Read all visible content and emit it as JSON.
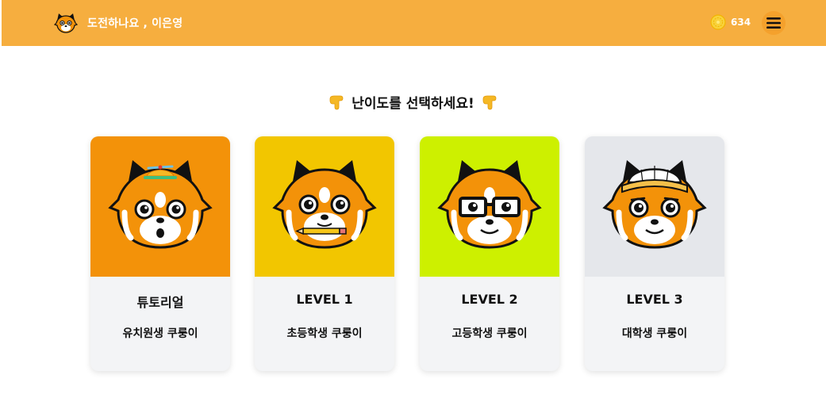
{
  "header": {
    "greeting": "도전하나요 , 이은영",
    "coins": "634",
    "colors": {
      "bar": "#f6ae3f",
      "text": "#ffffff"
    }
  },
  "prompt": {
    "text": "난이도를 선택하세요!"
  },
  "levels": [
    {
      "title": "튜토리얼",
      "subtitle": "유치원생 쿠룽이",
      "bg": "#f39209",
      "icon": "red-panda-propeller-hat-icon"
    },
    {
      "title": "LEVEL 1",
      "subtitle": "초등학생 쿠룽이",
      "bg": "#f2c600",
      "icon": "red-panda-pencil-icon"
    },
    {
      "title": "LEVEL 2",
      "subtitle": "고등학생 쿠룽이",
      "bg": "#cdf000",
      "icon": "red-panda-glasses-icon"
    },
    {
      "title": "LEVEL 3",
      "subtitle": "대학생 쿠룽이",
      "bg": "#e5e7eb",
      "icon": "red-panda-cap-icon"
    }
  ]
}
